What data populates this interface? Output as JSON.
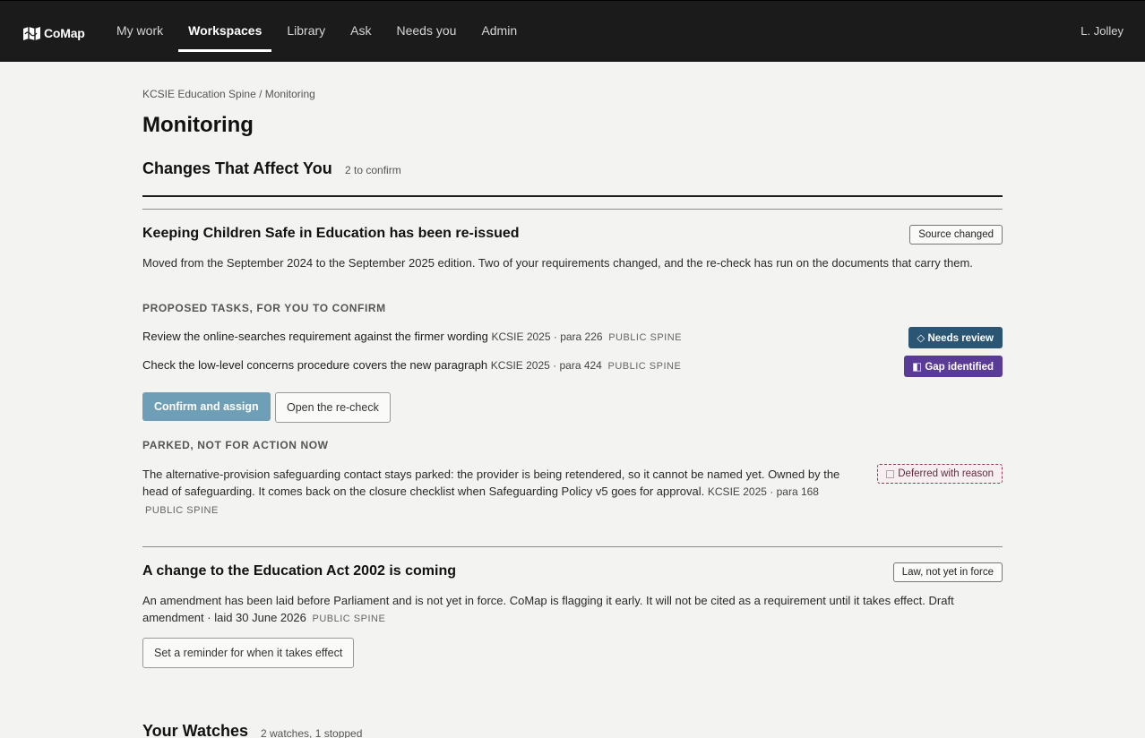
{
  "app": {
    "logo_text": "CoMap",
    "user": "L. Jolley"
  },
  "nav": {
    "items": [
      {
        "label": "My work"
      },
      {
        "label": "Workspaces"
      },
      {
        "label": "Library"
      },
      {
        "label": "Ask"
      },
      {
        "label": "Needs you"
      },
      {
        "label": "Admin"
      }
    ],
    "active": "Workspaces"
  },
  "breadcrumb": {
    "parent": "KCSIE Education Spine",
    "separator": " / ",
    "current": "Monitoring"
  },
  "page_title": "Monitoring",
  "changes": {
    "title": "Changes That Affect You",
    "count": "2 to confirm",
    "card1": {
      "title": "Keeping Children Safe in Education has been re-issued",
      "badge": "Source changed",
      "description": "Moved from the September 2024 to the September 2025 edition. Two of your requirements changed, and the re-check has run on the documents that carry them.",
      "proposed_heading": "PROPOSED TASKS, FOR YOU TO CONFIRM",
      "tasks": [
        {
          "text": "Review the online-searches requirement against the firmer wording",
          "ref": "KCSIE 2025 · para 226",
          "tag": "PUBLIC SPINE",
          "status": "Needs review",
          "status_icon": "◇"
        },
        {
          "text": "Check the low-level concerns procedure covers the new paragraph",
          "ref": "KCSIE 2025 · para 424",
          "tag": "PUBLIC SPINE",
          "status": "Gap identified",
          "status_icon": "◧"
        }
      ],
      "confirm_button": "Confirm and assign",
      "recheck_button": "Open the re-check",
      "parked_heading": "PARKED, NOT FOR ACTION NOW",
      "parked_text": "The alternative-provision safeguarding contact stays parked: the provider is being retendered, so it cannot be named yet. Owned by the head of safeguarding. It comes back on the closure checklist when Safeguarding Policy v5 goes for approval.",
      "parked_ref": "KCSIE 2025 · para 168",
      "parked_tag": "PUBLIC SPINE",
      "parked_badge": "Deferred with reason"
    },
    "card2": {
      "title": "A change to the Education Act 2002 is coming",
      "badge": "Law, not yet in force",
      "description": "An amendment has been laid before Parliament and is not yet in force. CoMap is flagging it early. It will not be cited as a requirement until it takes effect.",
      "ref": "Draft amendment · laid 30 June 2026",
      "tag": "PUBLIC SPINE",
      "reminder_button": "Set a reminder for when it takes effect"
    }
  },
  "watches": {
    "title": "Your Watches",
    "count": "2 watches, 1 stopped"
  }
}
